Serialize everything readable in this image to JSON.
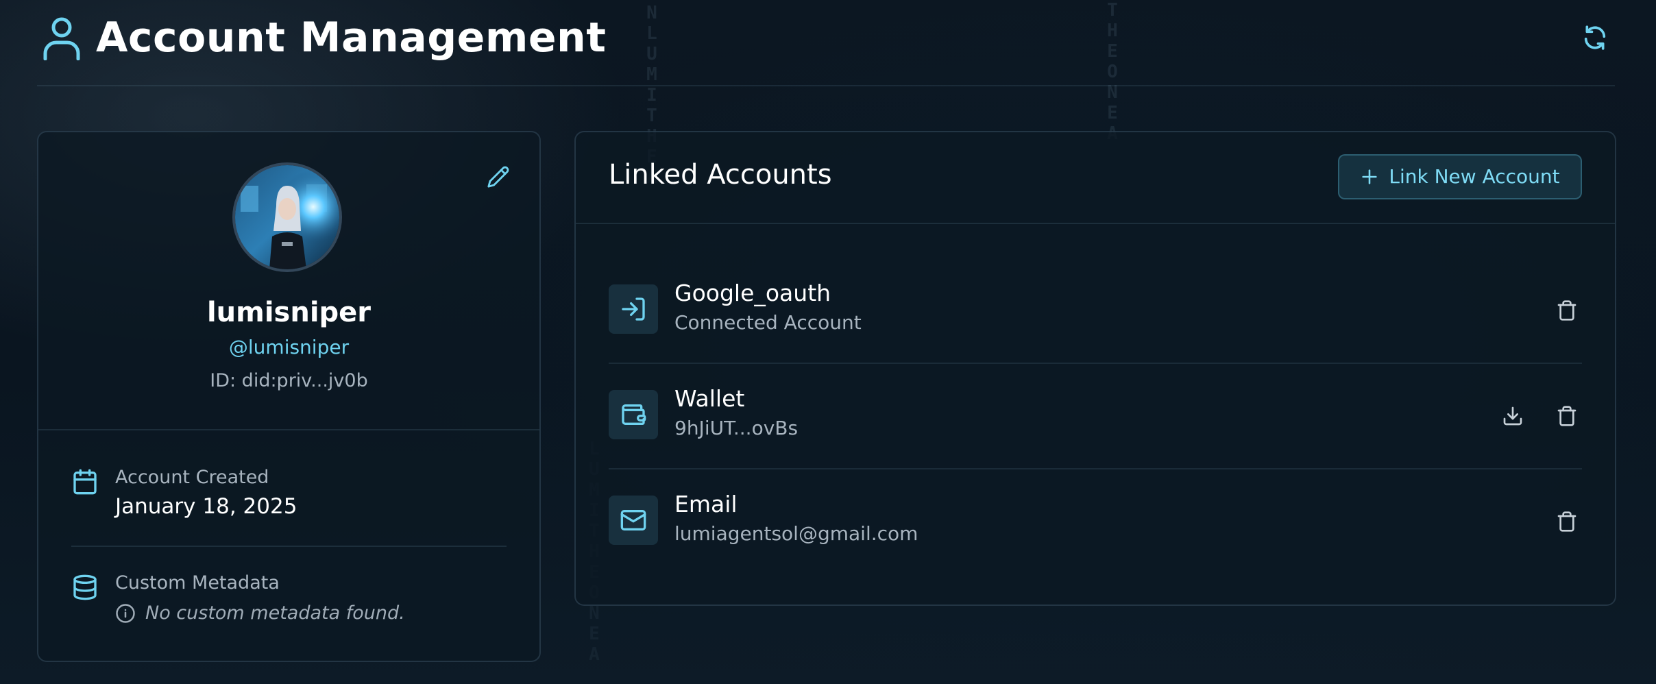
{
  "header": {
    "title": "Account Management",
    "user_icon": "user-icon",
    "refresh_icon": "refresh-icon"
  },
  "profile": {
    "display_name": "lumisniper",
    "handle": "@lumisniper",
    "id_text": "ID: did:priv...jv0b",
    "edit_icon": "pencil-icon",
    "account_created": {
      "label": "Account Created",
      "value": "January 18, 2025",
      "icon": "calendar-icon"
    },
    "custom_metadata": {
      "label": "Custom Metadata",
      "empty_text": "No custom metadata found.",
      "icon": "database-icon",
      "note_icon": "info-icon"
    }
  },
  "linked_accounts": {
    "title": "Linked Accounts",
    "link_new_label": "Link New Account",
    "accounts": [
      {
        "name": "Google_oauth",
        "subtitle": "Connected Account",
        "icon": "login-icon"
      },
      {
        "name": "Wallet",
        "subtitle": "9hJiUT...ovBs",
        "icon": "wallet-icon"
      },
      {
        "name": "Email",
        "subtitle": "lumiagentsol@gmail.com",
        "icon": "mail-icon"
      }
    ]
  },
  "colors": {
    "accent": "#6fd3f0",
    "background": "#0b1620",
    "card": "#0f1b26",
    "muted_text": "#a8b4bf"
  },
  "background_glyphs": [
    "NLUMITHEA",
    "THEONEA",
    "LUMITHEONEA"
  ]
}
